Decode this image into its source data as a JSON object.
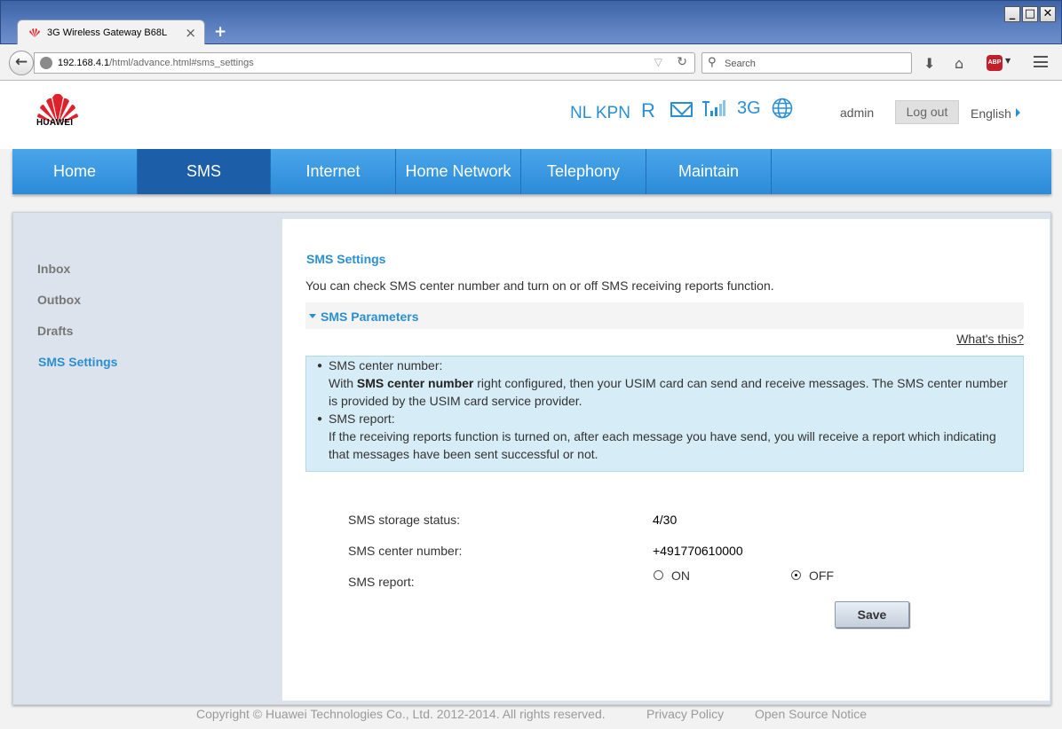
{
  "browser": {
    "tab_title": "3G Wireless Gateway B68L",
    "tab_close": "×",
    "new_tab": "+",
    "url_host": "192.168.4.1",
    "url_rest": "/html/advance.html#sms_settings",
    "search_placeholder": "Search",
    "window_buttons": [
      "_",
      "□",
      "✕"
    ]
  },
  "header": {
    "brand": "HUAWEI",
    "carrier": "NL KPN",
    "roaming": "R",
    "network_type": "3G",
    "user": "admin",
    "logout_label": "Log out",
    "language": "English",
    "brand_color": "#e0202a",
    "status_color": "#2a8fd2"
  },
  "nav": {
    "items": [
      "Home",
      "SMS",
      "Internet",
      "Home Network",
      "Telephony",
      "Maintain"
    ],
    "active": "SMS"
  },
  "sidebar": {
    "items": [
      "Inbox",
      "Outbox",
      "Drafts",
      "SMS Settings"
    ],
    "active": "SMS Settings"
  },
  "panel": {
    "title": "SMS Settings",
    "description": "You can check SMS center number and turn on or off SMS receiving reports function.",
    "section_label": "SMS Parameters",
    "whats_this": "What's this?",
    "help": {
      "item1_title": "SMS center number:",
      "item1_pre": "With ",
      "item1_bold": "SMS center number",
      "item1_post": " right configured, then your USIM card can send and receive messages. The SMS center number",
      "item1_line2": "is provided by the USIM card service provider.",
      "item2_title": "SMS report:",
      "item2_line1": "If the receiving reports function is turned on, after each message you have send, you will receive a report which indicating",
      "item2_line2": "that messages have been sent successful or not."
    },
    "storage_label": "SMS storage status:",
    "storage_value": "4/30",
    "center_label": "SMS center number:",
    "center_value": "+491770610000",
    "report_label": "SMS report:",
    "report_on": "ON",
    "report_off": "OFF",
    "report_selected": "OFF",
    "save_label": "Save"
  },
  "footer": {
    "copyright": "Copyright © Huawei Technologies Co., Ltd. 2012-2014. All rights reserved.",
    "privacy": "Privacy Policy",
    "open_source": "Open Source Notice"
  }
}
